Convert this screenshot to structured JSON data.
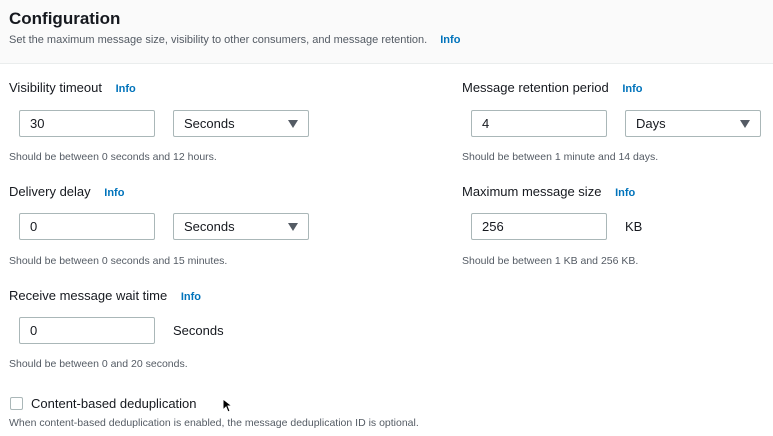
{
  "config": {
    "title": "Configuration",
    "subtitle": "Set the maximum message size, visibility to other consumers, and message retention.",
    "info_label": "Info"
  },
  "visibility_timeout": {
    "label": "Visibility timeout",
    "value": "30",
    "unit": "Seconds",
    "hint": "Should be between 0 seconds and 12 hours."
  },
  "retention_period": {
    "label": "Message retention period",
    "value": "4",
    "unit": "Days",
    "hint": "Should be between 1 minute and 14 days."
  },
  "delivery_delay": {
    "label": "Delivery delay",
    "value": "0",
    "unit": "Seconds",
    "hint": "Should be between 0 seconds and 15 minutes."
  },
  "max_message_size": {
    "label": "Maximum message size",
    "value": "256",
    "unit": "KB",
    "hint": "Should be between 1 KB and 256 KB."
  },
  "receive_wait_time": {
    "label": "Receive message wait time",
    "value": "0",
    "unit": "Seconds",
    "hint": "Should be between 0 and 20 seconds."
  },
  "content_dedup": {
    "label": "Content-based deduplication",
    "checked": false,
    "hint": "When content-based deduplication is enabled, the message deduplication ID is optional."
  },
  "colors": {
    "link": "#0073bb",
    "text": "#16191f",
    "muted": "#545b64",
    "border": "#aab7b8"
  }
}
